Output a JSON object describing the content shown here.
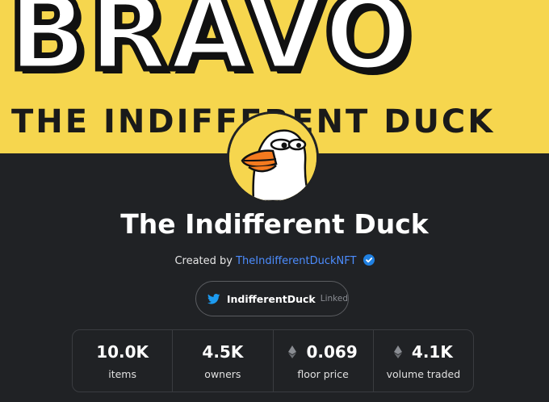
{
  "banner": {
    "headline": "BRAVO",
    "subline": "THE INDIFFERENT DUCK"
  },
  "collection": {
    "name": "The Indifferent Duck",
    "created_by_prefix": "Created by",
    "creator": "TheIndifferentDuckNFT"
  },
  "twitter": {
    "handle": "IndifferentDuck",
    "status": "Linked"
  },
  "stats": [
    {
      "value": "10.0K",
      "label": "items",
      "eth": false
    },
    {
      "value": "4.5K",
      "label": "owners",
      "eth": false
    },
    {
      "value": "0.069",
      "label": "floor price",
      "eth": true
    },
    {
      "value": "4.1K",
      "label": "volume traded",
      "eth": true
    }
  ],
  "colors": {
    "background": "#202225",
    "banner": "#f6d64e",
    "link": "#4c8dff",
    "twitter": "#1d9bf0"
  }
}
